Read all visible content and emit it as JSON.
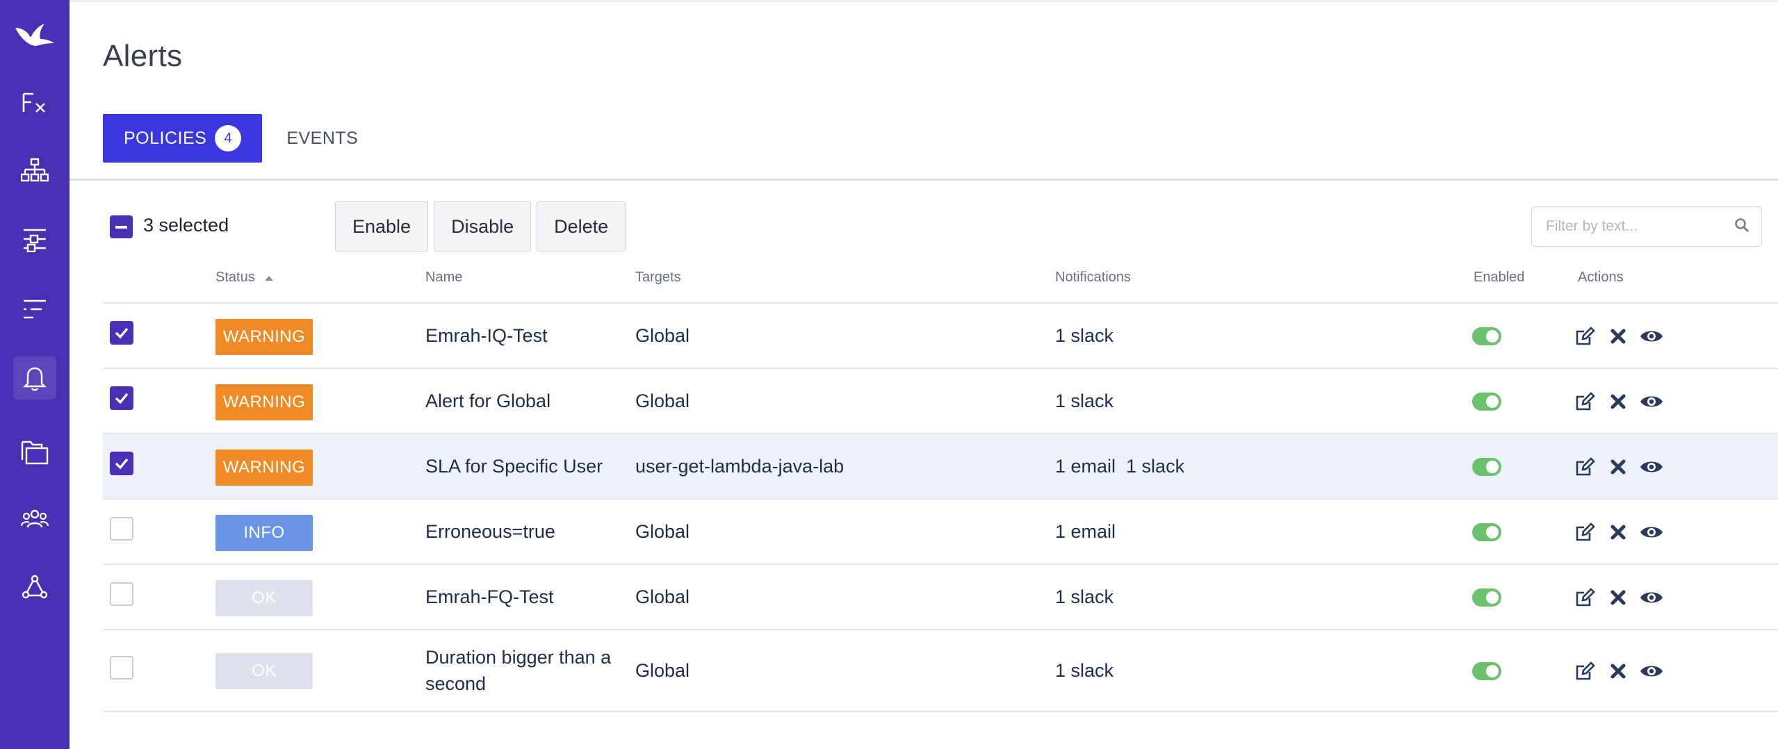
{
  "page": {
    "title": "Alerts"
  },
  "sidebar": {
    "items": [
      {
        "icon": "bird-logo-icon"
      },
      {
        "icon": "function-icon"
      },
      {
        "icon": "topology-icon"
      },
      {
        "icon": "filter-sliders-icon"
      },
      {
        "icon": "list-icon"
      },
      {
        "icon": "bell-icon",
        "active": true
      },
      {
        "icon": "folders-icon"
      },
      {
        "icon": "team-icon"
      },
      {
        "icon": "integrations-icon"
      }
    ]
  },
  "tabs": [
    {
      "label": "POLICIES",
      "count": "4",
      "active": true
    },
    {
      "label": "EVENTS",
      "active": false
    }
  ],
  "toolbar": {
    "selected_text": "3 selected",
    "enable_label": "Enable",
    "disable_label": "Disable",
    "delete_label": "Delete",
    "filter_placeholder": "Filter by text..."
  },
  "table": {
    "columns": {
      "status": "Status",
      "name": "Name",
      "targets": "Targets",
      "notifications": "Notifications",
      "enabled": "Enabled",
      "actions": "Actions"
    },
    "rows": [
      {
        "checked": true,
        "status": "WARNING",
        "name": "Emrah-IQ-Test",
        "target": "Global",
        "notifications": "1 slack",
        "enabled": true
      },
      {
        "checked": true,
        "status": "WARNING",
        "name": "Alert for Global",
        "target": "Global",
        "notifications": "1 slack",
        "enabled": true
      },
      {
        "checked": true,
        "status": "WARNING",
        "name": "SLA for Specific User",
        "target": "user-get-lambda-java-lab",
        "notifications": "1 email  1 slack",
        "enabled": true
      },
      {
        "checked": false,
        "status": "INFO",
        "name": "Erroneous=true",
        "target": "Global",
        "notifications": "1 email",
        "enabled": true
      },
      {
        "checked": false,
        "status": "OK",
        "name": "Emrah-FQ-Test",
        "target": "Global",
        "notifications": "1 slack",
        "enabled": true
      },
      {
        "checked": false,
        "status": "OK",
        "name_line1": "Duration bigger than a",
        "name_line2": "second",
        "target": "Global",
        "notifications": "1 slack",
        "enabled": true
      }
    ]
  },
  "colors": {
    "sidebar": "#4a2fb5",
    "accent": "#3a36e0",
    "warning": "#f08a24",
    "info": "#6a95e6",
    "ok": "#dfe2ec",
    "toggle_on": "#6cc26c"
  }
}
